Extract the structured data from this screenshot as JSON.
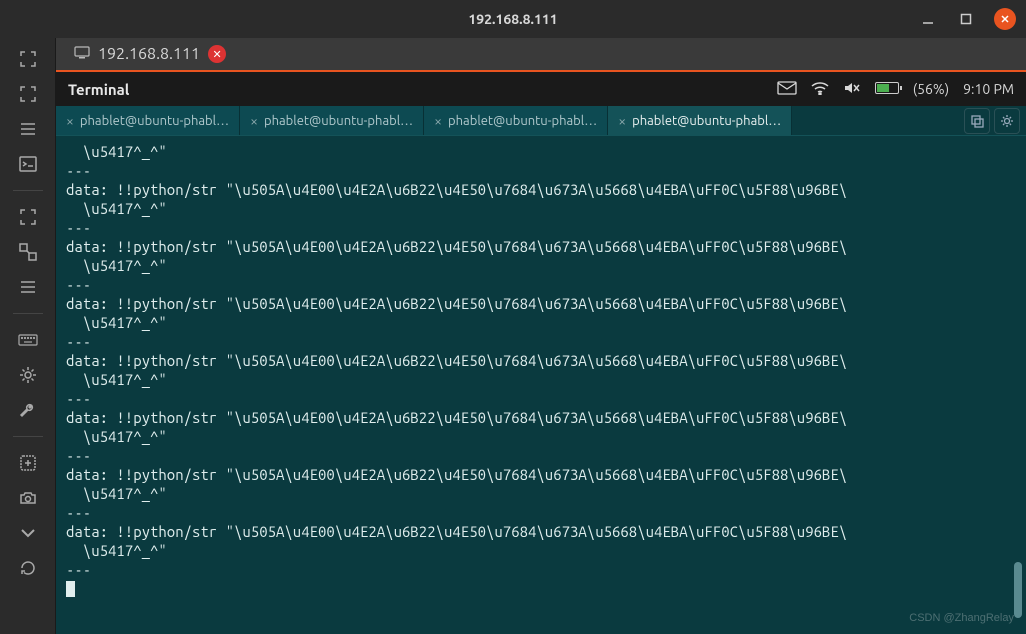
{
  "titlebar": {
    "title": "192.168.8.111"
  },
  "connection_tab": {
    "label": "192.168.8.111"
  },
  "panel": {
    "title": "Terminal"
  },
  "status_bar": {
    "battery": "(56%)",
    "time": "9:10 PM"
  },
  "inner_tabs": {
    "items": [
      {
        "label": "phablet@ubuntu-phabl…",
        "active": false
      },
      {
        "label": "phablet@ubuntu-phabl…",
        "active": false
      },
      {
        "label": "phablet@ubuntu-phabl…",
        "active": false
      },
      {
        "label": "phablet@ubuntu-phabl…",
        "active": true
      }
    ]
  },
  "terminal": {
    "lines": [
      "  \\u5417^_^\"",
      "---",
      "data: !!python/str \"\\u505A\\u4E00\\u4E2A\\u6B22\\u4E50\\u7684\\u673A\\u5668\\u4EBA\\uFF0C\\u5F88\\u96BE\\",
      "  \\u5417^_^\"",
      "---",
      "data: !!python/str \"\\u505A\\u4E00\\u4E2A\\u6B22\\u4E50\\u7684\\u673A\\u5668\\u4EBA\\uFF0C\\u5F88\\u96BE\\",
      "  \\u5417^_^\"",
      "---",
      "data: !!python/str \"\\u505A\\u4E00\\u4E2A\\u6B22\\u4E50\\u7684\\u673A\\u5668\\u4EBA\\uFF0C\\u5F88\\u96BE\\",
      "  \\u5417^_^\"",
      "---",
      "data: !!python/str \"\\u505A\\u4E00\\u4E2A\\u6B22\\u4E50\\u7684\\u673A\\u5668\\u4EBA\\uFF0C\\u5F88\\u96BE\\",
      "  \\u5417^_^\"",
      "---",
      "data: !!python/str \"\\u505A\\u4E00\\u4E2A\\u6B22\\u4E50\\u7684\\u673A\\u5668\\u4EBA\\uFF0C\\u5F88\\u96BE\\",
      "  \\u5417^_^\"",
      "---",
      "data: !!python/str \"\\u505A\\u4E00\\u4E2A\\u6B22\\u4E50\\u7684\\u673A\\u5668\\u4EBA\\uFF0C\\u5F88\\u96BE\\",
      "  \\u5417^_^\"",
      "---",
      "data: !!python/str \"\\u505A\\u4E00\\u4E2A\\u6B22\\u4E50\\u7684\\u673A\\u5668\\u4EBA\\uFF0C\\u5F88\\u96BE\\",
      "  \\u5417^_^\"",
      "---"
    ]
  },
  "watermark": "CSDN @ZhangRelay"
}
